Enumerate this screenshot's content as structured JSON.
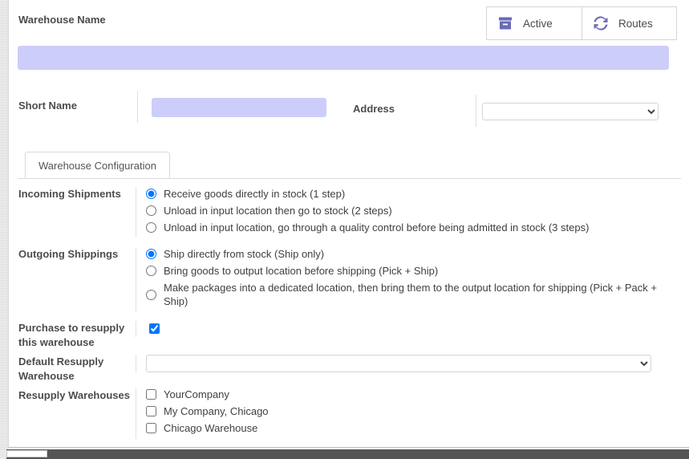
{
  "stat_buttons": [
    {
      "label": "Active",
      "icon": "archive-box-icon"
    },
    {
      "label": "Routes",
      "icon": "refresh-sync-icon"
    }
  ],
  "header": {
    "warehouse_name_label": "Warehouse Name",
    "warehouse_name_value": "",
    "warehouse_name_placeholder": ""
  },
  "identity": {
    "short_name_label": "Short Name",
    "short_name_value": "",
    "short_name_placeholder": "",
    "address_label": "Address",
    "address_value": "",
    "address_options": [
      ""
    ]
  },
  "tabs": [
    {
      "label": "Warehouse Configuration",
      "active": true
    }
  ],
  "fields": {
    "incoming": {
      "label": "Incoming Shipments",
      "options": [
        {
          "text": "Receive goods directly in stock (1 step)",
          "checked": true
        },
        {
          "text": "Unload in input location then go to stock (2 steps)",
          "checked": false
        },
        {
          "text": "Unload in input location, go through a quality control before being admitted in stock (3 steps)",
          "checked": false
        }
      ]
    },
    "outgoing": {
      "label": "Outgoing Shippings",
      "options": [
        {
          "text": "Ship directly from stock (Ship only)",
          "checked": true
        },
        {
          "text": "Bring goods to output location before shipping (Pick + Ship)",
          "checked": false
        },
        {
          "text": "Make packages into a dedicated location, then bring them to the output location for shipping (Pick + Pack + Ship)",
          "checked": false
        }
      ]
    },
    "purchase_resupply": {
      "label": "Purchase to resupply this warehouse",
      "checked": true
    },
    "default_resupply": {
      "label": "Default Resupply Warehouse",
      "value": "",
      "options": [
        ""
      ]
    },
    "resupply_warehouses": {
      "label": "Resupply Warehouses",
      "options": [
        {
          "text": "YourCompany",
          "checked": false
        },
        {
          "text": "My Company, Chicago",
          "checked": false
        },
        {
          "text": "Chicago Warehouse",
          "checked": false
        }
      ]
    }
  },
  "colors": {
    "input_highlight": "#cdcdfa",
    "icon_accent": "#6a6ab8",
    "text": "#4c4c4c"
  }
}
